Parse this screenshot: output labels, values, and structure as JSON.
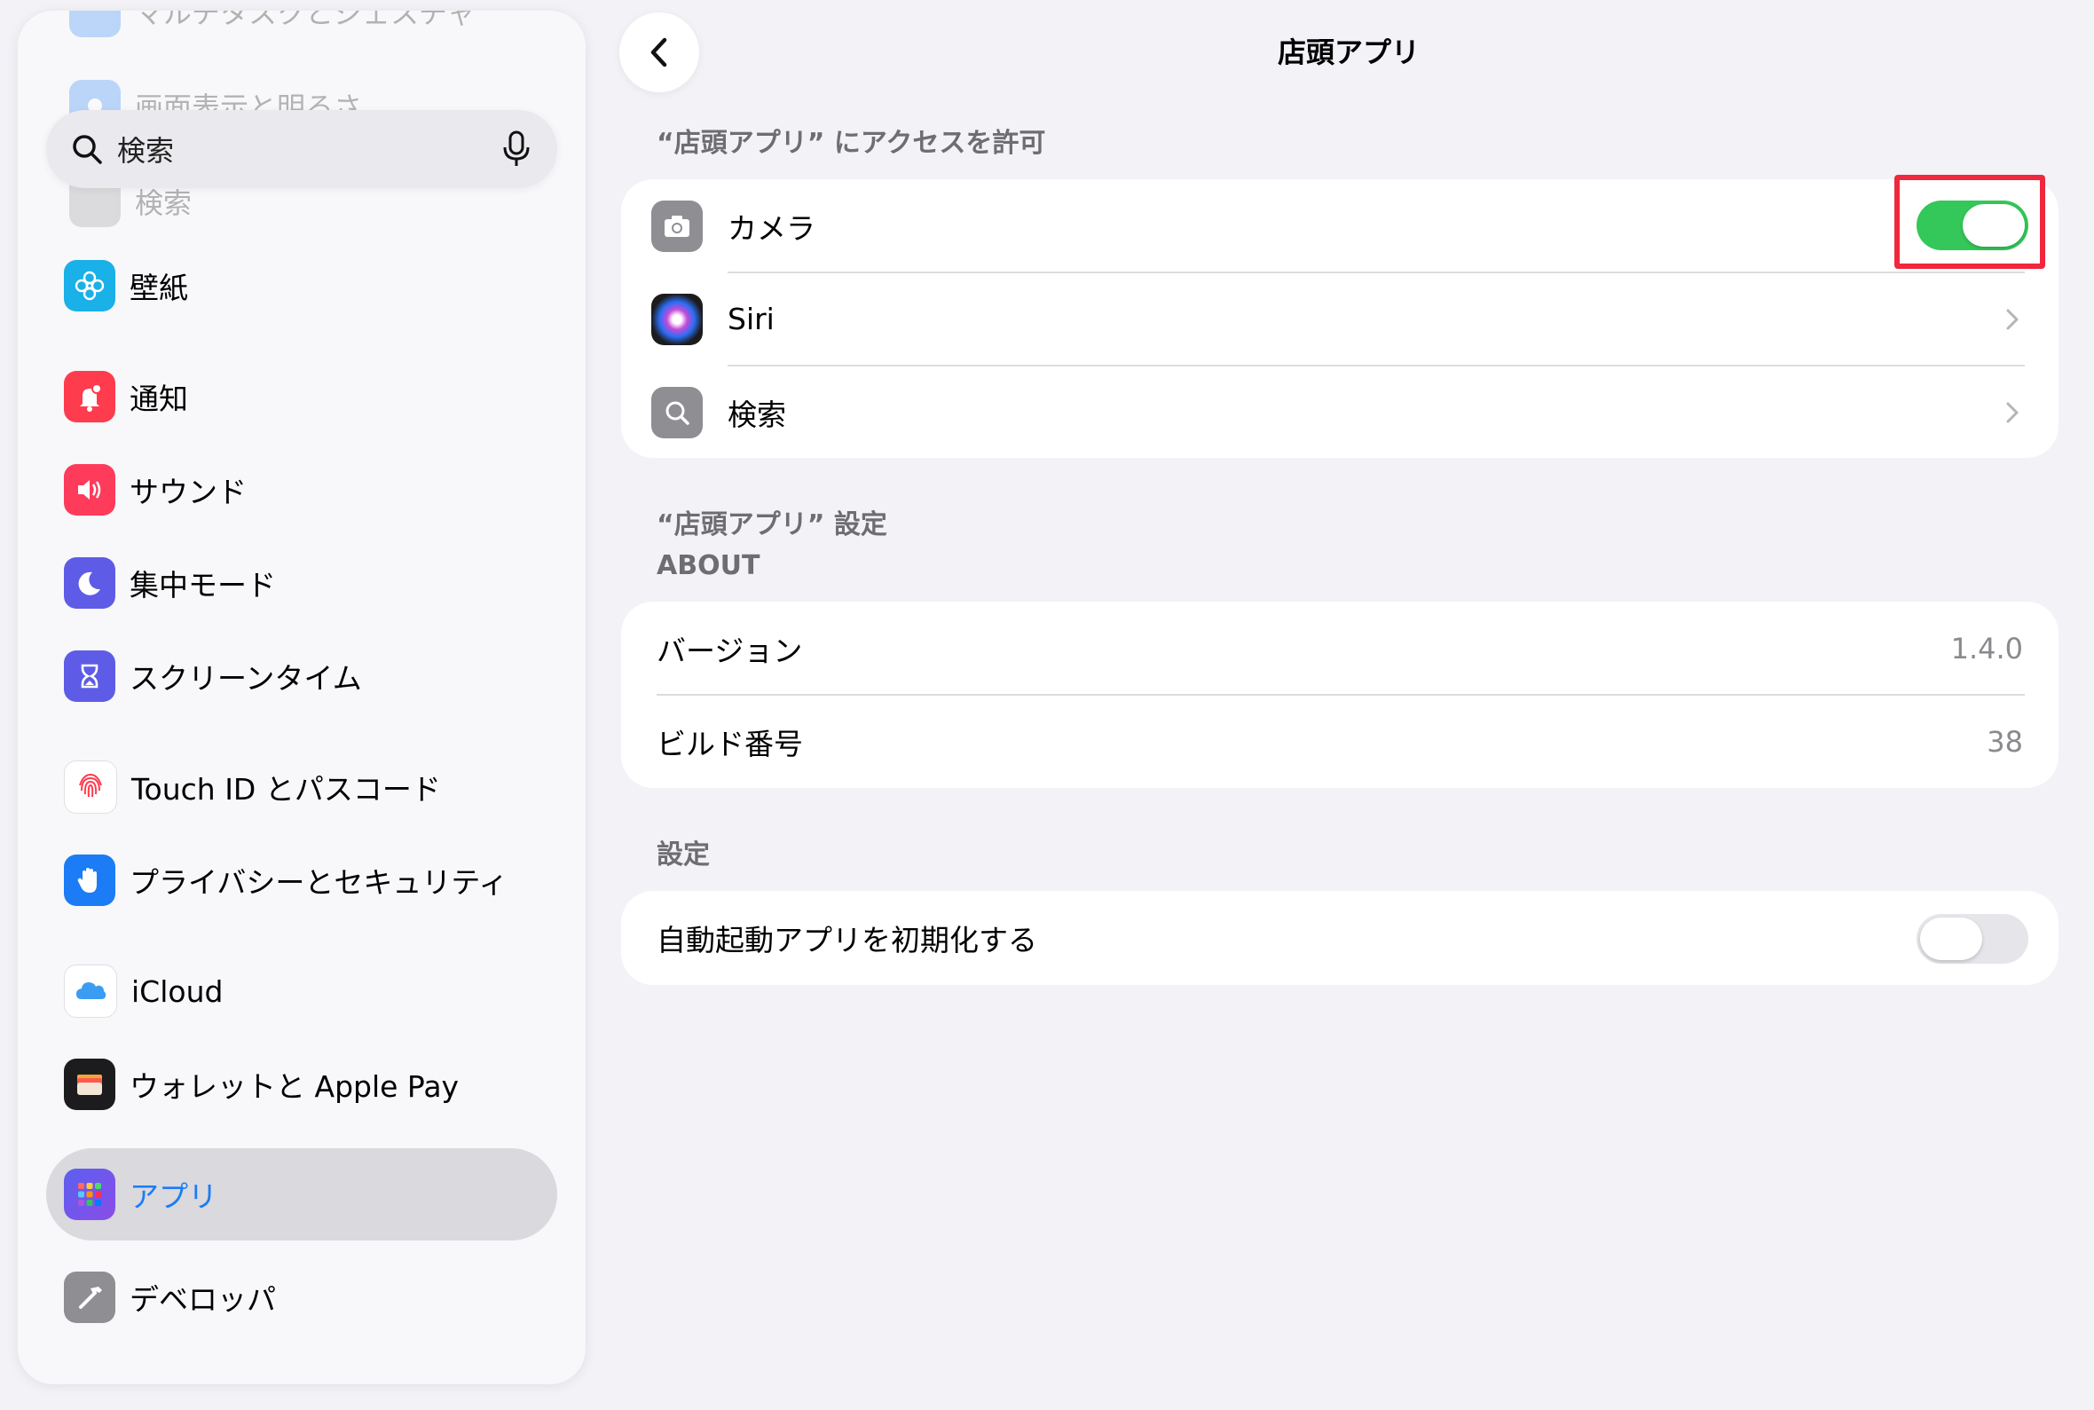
{
  "sidebar": {
    "faded_top": "マルチタスクとジェスチャ",
    "faded_display": "画面表示と明るさ",
    "faded_search": "検索",
    "search_placeholder": "検索",
    "items": [
      {
        "label": "壁紙",
        "icon": "wallpaper-icon"
      },
      {
        "label": "通知",
        "icon": "notifications-icon"
      },
      {
        "label": "サウンド",
        "icon": "sound-icon"
      },
      {
        "label": "集中モード",
        "icon": "focus-moon-icon"
      },
      {
        "label": "スクリーンタイム",
        "icon": "hourglass-icon"
      },
      {
        "label": "Touch ID とパスコード",
        "icon": "fingerprint-icon"
      },
      {
        "label": "プライバシーとセキュリティ",
        "icon": "privacy-hand-icon"
      },
      {
        "label": "iCloud",
        "icon": "icloud-icon"
      },
      {
        "label": "ウォレットと Apple Pay",
        "icon": "wallet-icon"
      },
      {
        "label": "アプリ",
        "icon": "apps-grid-icon"
      },
      {
        "label": "デベロッパ",
        "icon": "hammer-icon"
      }
    ],
    "selected_item": "アプリ"
  },
  "nav": {
    "title": "店頭アプリ"
  },
  "access_section": {
    "header": "“店頭アプリ” にアクセスを許可",
    "rows": [
      {
        "label": "カメラ",
        "icon": "camera-icon",
        "toggle": true
      },
      {
        "label": "Siri",
        "icon": "siri-icon"
      },
      {
        "label": "検索",
        "icon": "search-icon"
      }
    ]
  },
  "settings_section": {
    "header_line1": "“店頭アプリ” 設定",
    "header_line2": "ABOUT",
    "rows": [
      {
        "label": "バージョン",
        "value": "1.4.0"
      },
      {
        "label": "ビルド番号",
        "value": "38"
      }
    ]
  },
  "config_section": {
    "header": "設定",
    "rows": [
      {
        "label": "自動起動アプリを初期化する",
        "toggle": false
      }
    ]
  },
  "colors": {
    "accent": "#1b7cf5",
    "toggle_on": "#34c759",
    "highlight": "#f0273d"
  }
}
